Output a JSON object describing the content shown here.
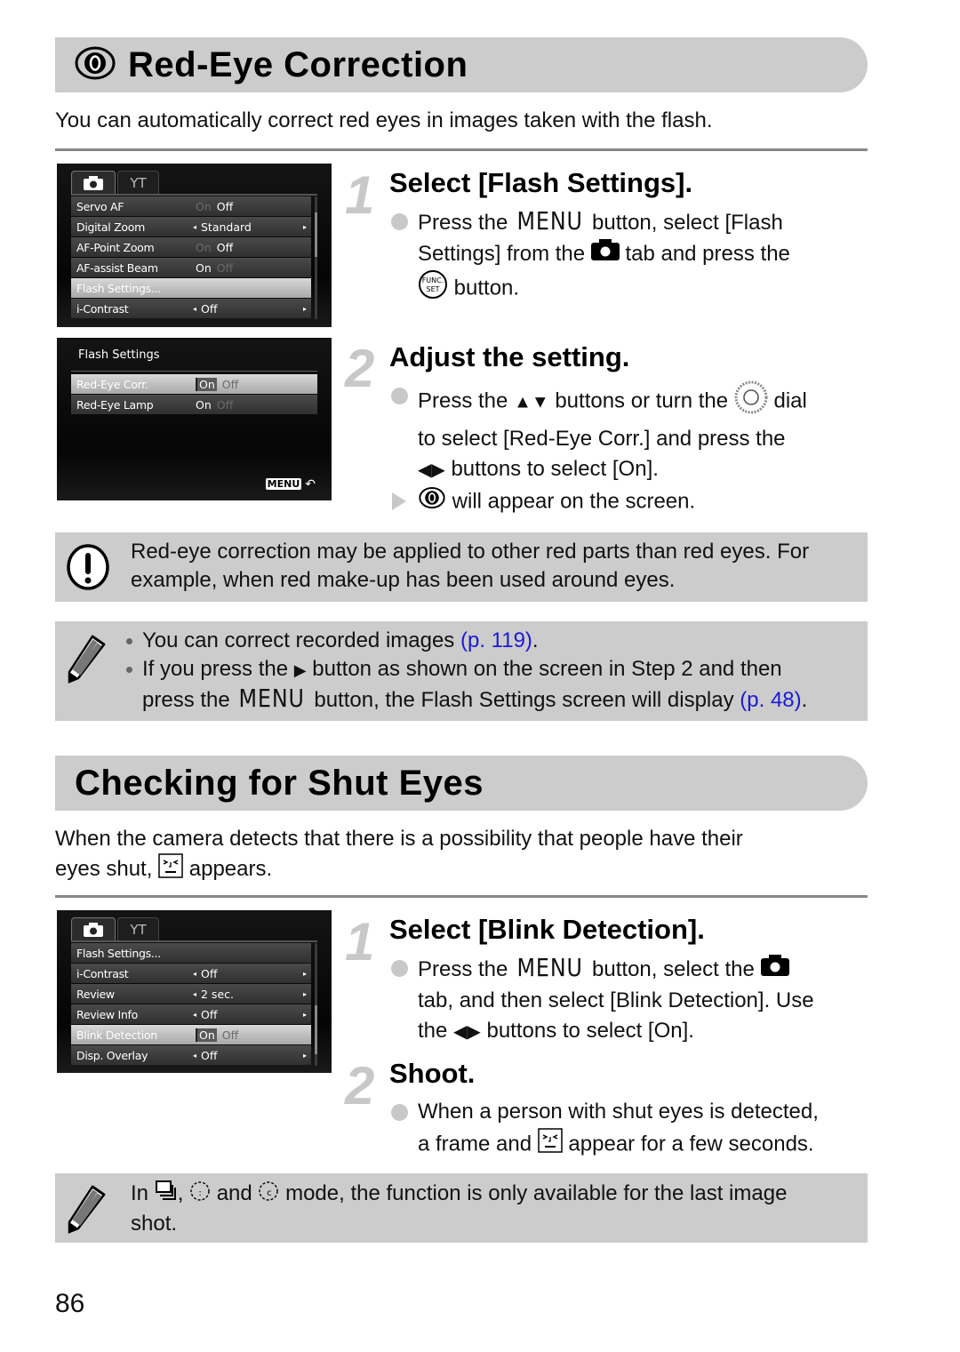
{
  "section1": {
    "icon": "red-eye-icon",
    "title": "Red-Eye Correction",
    "intro": "You can automatically correct red eyes in images taken with the flash.",
    "screen1": {
      "tabs": [
        {
          "icon": "camera-icon",
          "active": true
        },
        {
          "icon": "tools-icon",
          "active": false
        }
      ],
      "rows": [
        {
          "label": "Servo AF",
          "values": [
            "On",
            "Off"
          ],
          "active_index": 1,
          "type": "toggle"
        },
        {
          "label": "Digital Zoom",
          "value": "Standard",
          "type": "choice"
        },
        {
          "label": "AF-Point Zoom",
          "values": [
            "On",
            "Off"
          ],
          "active_index": 1,
          "type": "toggle"
        },
        {
          "label": "AF-assist Beam",
          "values": [
            "On",
            "Off"
          ],
          "active_index": 0,
          "type": "toggle"
        },
        {
          "label": "Flash Settings...",
          "type": "submenu",
          "selected": true
        },
        {
          "label": "i-Contrast",
          "value": "Off",
          "type": "choice"
        }
      ]
    },
    "screen2": {
      "title": "Flash Settings",
      "rows": [
        {
          "label": "Red-Eye Corr.",
          "values": [
            "On",
            "Off"
          ],
          "active_index": 0,
          "selected": true
        },
        {
          "label": "Red-Eye Lamp",
          "values": [
            "On",
            "Off"
          ],
          "active_index": 0,
          "selected": false
        }
      ],
      "menu_badge": "MENU",
      "back_icon": "return-arrow-icon"
    },
    "steps": [
      {
        "number": "1",
        "title": "Select [Flash Settings].",
        "text_parts": {
          "a": "Press the",
          "menu": "MENU",
          "b": "button, select [Flash",
          "c": "Settings] from the",
          "d": "tab and press the",
          "e": "button."
        }
      },
      {
        "number": "2",
        "title": "Adjust the setting.",
        "text_parts": {
          "a": "Press the",
          "b": "buttons or turn the",
          "c": "dial",
          "d": "to select [Red-Eye Corr.] and press the",
          "e": "buttons to select [On].",
          "result": "will appear on the screen."
        }
      }
    ],
    "caution": "Red-eye correction may be applied to other red parts than red eyes. For example, when red make-up has been used around eyes.",
    "notes": {
      "n1_text": "You can correct recorded images",
      "n1_link": "(p. 119)",
      "n2_a": "If you press the",
      "n2_b": "button as shown on the screen in Step 2 and then",
      "n2_c": "press the",
      "n2_menu": "MENU",
      "n2_d": "button, the Flash Settings screen will display",
      "n2_link": "(p. 48)"
    }
  },
  "section2": {
    "title": "Checking for Shut Eyes",
    "intro_a": "When the camera detects that there is a possibility that people have their",
    "intro_b": "eyes shut,",
    "intro_c": "appears.",
    "screen": {
      "tabs": [
        {
          "icon": "camera-icon",
          "active": true
        },
        {
          "icon": "tools-icon",
          "active": false
        }
      ],
      "rows": [
        {
          "label": "Flash Settings...",
          "type": "submenu"
        },
        {
          "label": "i-Contrast",
          "value": "Off",
          "type": "choice"
        },
        {
          "label": "Review",
          "value": "2 sec.",
          "type": "choice"
        },
        {
          "label": "Review Info",
          "value": "Off",
          "type": "choice"
        },
        {
          "label": "Blink Detection",
          "values": [
            "On",
            "Off"
          ],
          "active_index": 0,
          "type": "toggle",
          "selected": true
        },
        {
          "label": "Disp. Overlay",
          "value": "Off",
          "type": "choice"
        }
      ]
    },
    "steps": [
      {
        "number": "1",
        "title": "Select [Blink Detection].",
        "text_parts": {
          "a": "Press the",
          "menu": "MENU",
          "b": "button, select the",
          "c": "tab, and then select [Blink Detection]. Use",
          "d": "the",
          "e": "buttons to select [On]."
        }
      },
      {
        "number": "2",
        "title": "Shoot.",
        "text_parts": {
          "a": "When a person with shut eyes is detected,",
          "b": "a frame and",
          "c": "appear for a few seconds."
        }
      }
    ],
    "note": {
      "a": "In",
      "b": ",",
      "c": "and",
      "d": "mode, the function is only available for the last image",
      "e": "shot."
    }
  },
  "page_number": "86",
  "colors": {
    "bar": "#cccccc",
    "link": "#1a1ad8",
    "step_number": "#c8c8c8"
  }
}
